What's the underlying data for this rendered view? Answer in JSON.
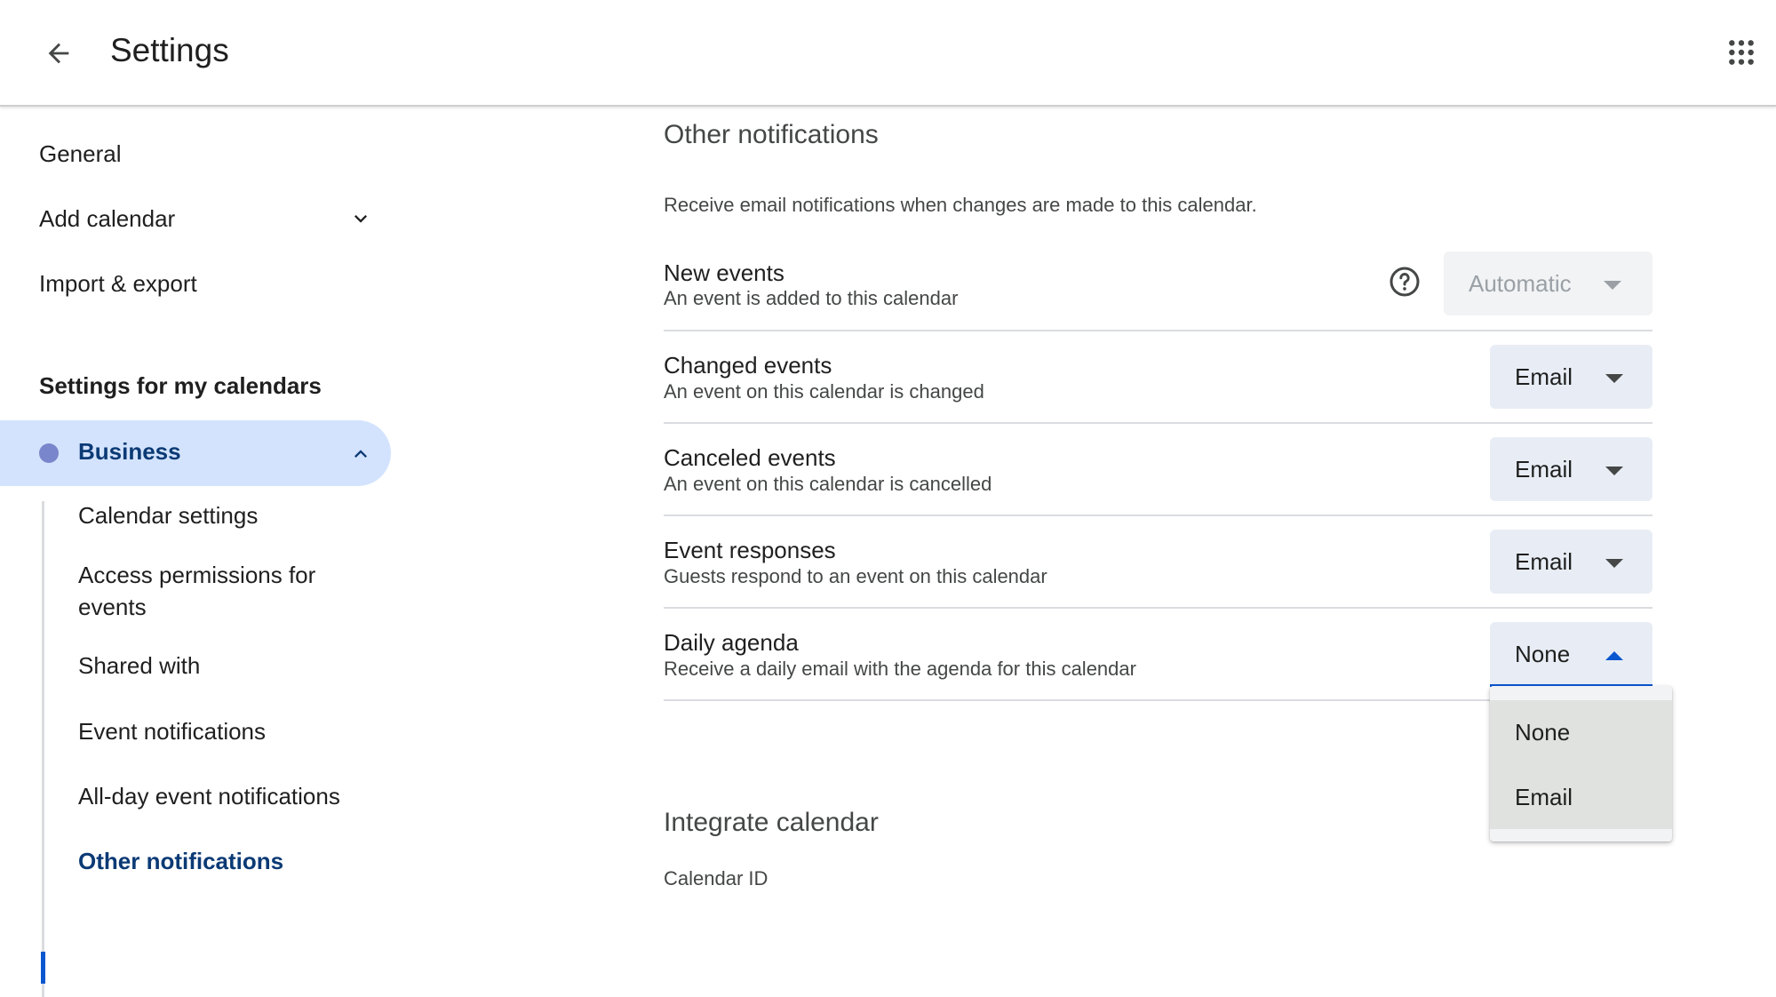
{
  "header": {
    "title": "Settings"
  },
  "sidebar": {
    "items": [
      {
        "label": "General"
      },
      {
        "label": "Add calendar"
      },
      {
        "label": "Import & export"
      }
    ],
    "section_title": "Settings for my calendars",
    "calendar": {
      "name": "Business",
      "color": "#7986cb"
    },
    "sub_items": [
      {
        "label": "Calendar settings"
      },
      {
        "label": "Access permissions for events"
      },
      {
        "label": "Shared with"
      },
      {
        "label": "Event notifications"
      },
      {
        "label": "All-day event notifications"
      },
      {
        "label": "Other notifications"
      }
    ]
  },
  "main": {
    "title": "Other notifications",
    "description": "Receive email notifications when changes are made to this calendar.",
    "rows": [
      {
        "title": "New events",
        "subtitle": "An event is added to this calendar",
        "value": "Automatic"
      },
      {
        "title": "Changed events",
        "subtitle": "An event on this calendar is changed",
        "value": "Email"
      },
      {
        "title": "Canceled events",
        "subtitle": "An event on this calendar is cancelled",
        "value": "Email"
      },
      {
        "title": "Event responses",
        "subtitle": "Guests respond to an event on this calendar",
        "value": "Email"
      },
      {
        "title": "Daily agenda",
        "subtitle": "Receive a daily email with the agenda for this calendar",
        "value": "None"
      }
    ],
    "dropdown_options": [
      "None",
      "Email"
    ],
    "next_section_title": "Integrate calendar",
    "calendar_id_label": "Calendar ID"
  },
  "colors": {
    "accent": "#0b57d0",
    "selected_bg": "#d3e3fd",
    "select_bg": "#e8edf5"
  }
}
